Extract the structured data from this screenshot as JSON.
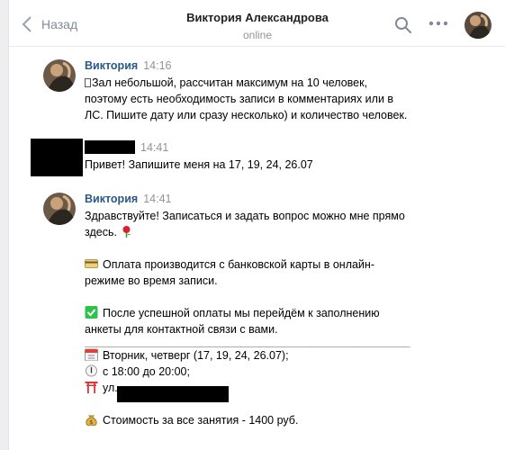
{
  "header": {
    "back_label": "Назад",
    "title": "Виктория Александрова",
    "status": "online"
  },
  "messages": [
    {
      "author": "Виктория",
      "time": "14:16",
      "lines": [
        "Зал небольшой, рассчитан максимум на 10 человек,",
        "поэтому есть необходимость записи в комментариях или в",
        "ЛС. Пишите дату или сразу несколько) и количество человек."
      ]
    },
    {
      "author": "",
      "time": "14:41",
      "lines": [
        "Привет! Запишите меня на 17, 19, 24, 26.07"
      ]
    },
    {
      "author": "Виктория",
      "time": "14:41",
      "greeting_1": "Здравствуйте! Записаться и задать вопрос можно мне прямо",
      "greeting_2": "здесь.",
      "payment_1": "Оплата производится с банковской карты в онлайн-",
      "payment_2": "режиме во время записи.",
      "after_1": "После успешной оплаты мы перейдём к заполнению",
      "after_2": "анкеты для контактной связи с вами.",
      "divider": "____________________________________________________",
      "days": "Вторник, четверг (17, 19, 24, 26.07);",
      "hours": "с 18:00 до 20:00;",
      "street": "ул.",
      "price": "Стоимость за все занятия - 1400 руб."
    }
  ],
  "icons": {
    "back": "chevron-left-icon",
    "search": "search-icon",
    "more": "more-dots-icon",
    "rose": "rose-emoji",
    "card": "credit-card-emoji",
    "check": "check-mark-emoji",
    "calendar": "calendar-emoji",
    "clock": "clock-emoji",
    "gate": "torii-gate-emoji",
    "money": "money-bag-emoji"
  },
  "colors": {
    "author": "#2a5885",
    "muted": "#939393",
    "check": "#2ec14b"
  }
}
